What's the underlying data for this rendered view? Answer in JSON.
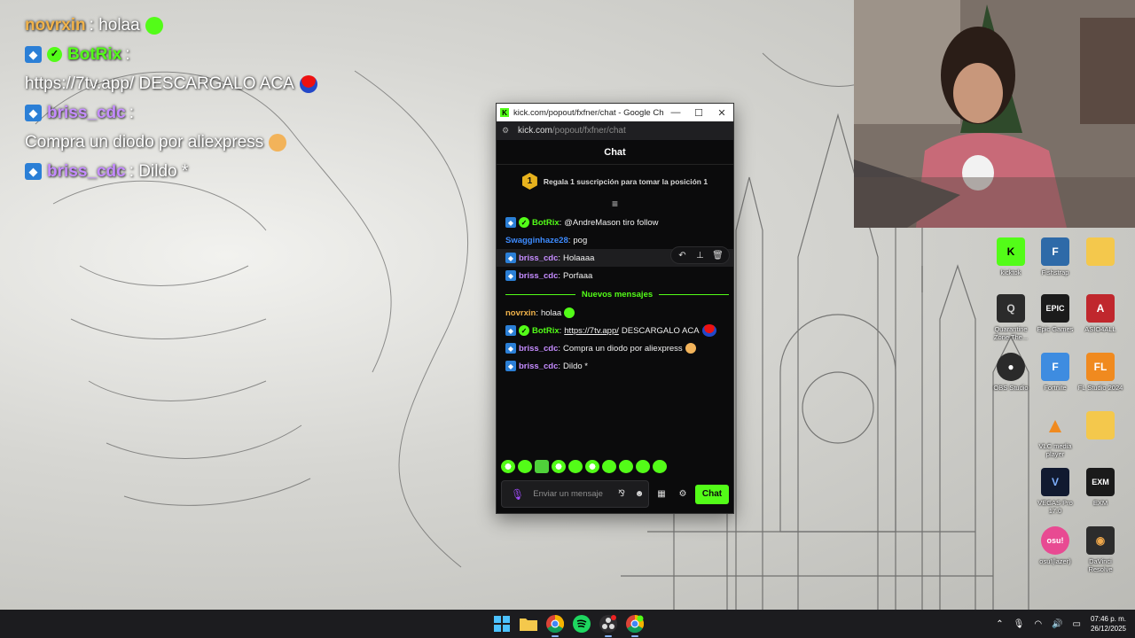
{
  "overlay_chat": [
    {
      "user": "novrxin",
      "user_color": "#f0b24a",
      "text": "holaa",
      "emote": "green",
      "badges": []
    },
    {
      "user": "BotRix",
      "user_color": "#53fc18",
      "text": "https://7tv.app/ DESCARGALO ACA",
      "emote": "santa",
      "badges": [
        "sub",
        "verified"
      ]
    },
    {
      "user": "briss_cdc",
      "user_color": "#c58cff",
      "text": "Compra un diodo por aliexpress",
      "emote": "smile",
      "badges": [
        "sub"
      ]
    },
    {
      "user": "briss_cdc",
      "user_color": "#c58cff",
      "text": "Dildo *",
      "emote": "",
      "badges": [
        "sub"
      ]
    }
  ],
  "popout": {
    "window_title": "kick.com/popout/fxfner/chat - Google Chro...",
    "favicon": "K",
    "address_domain": "kick.com",
    "address_path": "/popout/fxfner/chat",
    "header_title": "Chat",
    "pinned_rank": "1",
    "pinned_text": "Regala 1 suscripción para tomar la posición 1",
    "collapse_icon": "≡",
    "messages_top": [
      {
        "user": "BotRix",
        "color": "#53fc18",
        "text": "@AndreMason tiro follow",
        "badges": [
          "sub",
          "verified"
        ]
      },
      {
        "user": "Swagginhaze28",
        "color": "#3d8bff",
        "text": "pog",
        "badges": []
      },
      {
        "user": "briss_cdc",
        "color": "#c58cff",
        "text": "Holaaaa",
        "badges": [
          "sub"
        ]
      },
      {
        "user": "briss_cdc",
        "color": "#c58cff",
        "text": "Porfaaa",
        "badges": [
          "sub"
        ]
      }
    ],
    "new_messages_label": "Nuevos mensajes",
    "messages_new": [
      {
        "user": "novrxin",
        "color": "#f0b24a",
        "text": "holaa",
        "badges": []
      },
      {
        "user": "BotRix",
        "color": "#53fc18",
        "link": "https://7tv.app/",
        "text": "DESCARGALO ACA",
        "badges": [
          "sub",
          "verified"
        ]
      },
      {
        "user": "briss_cdc",
        "color": "#c58cff",
        "text": "Compra un diodo por aliexpress",
        "badges": [
          "sub"
        ]
      },
      {
        "user": "briss_cdc",
        "color": "#c58cff",
        "text": "Dildo *",
        "badges": [
          "sub"
        ]
      }
    ],
    "input_placeholder": "Enviar un mensaje",
    "send_label": "Chat"
  },
  "desktop_icons": [
    {
      "label": "kicktok",
      "color": "#53fc18",
      "glyph": "K"
    },
    {
      "label": "Fishstrap",
      "color": "#2e6aa8",
      "glyph": "F"
    },
    {
      "label": "",
      "color": "#f4c84c",
      "glyph": ""
    },
    {
      "label": "Quarantine Zone The...",
      "color": "#2b2b2b",
      "glyph": "Q"
    },
    {
      "label": "Epic Games",
      "color": "#1b1b1b",
      "glyph": "EPIC"
    },
    {
      "label": "ASIO4ALL",
      "color": "#c0272d",
      "glyph": "A"
    },
    {
      "label": "OBS Studio",
      "color": "#2a2a2a",
      "glyph": "●"
    },
    {
      "label": "Fortnite",
      "color": "#3e8ce0",
      "glyph": "F"
    },
    {
      "label": "FL Studio 2024",
      "color": "#f08a1f",
      "glyph": "FL"
    },
    {
      "label": "VLC media player",
      "color": "#f08a1f",
      "glyph": "▲"
    },
    {
      "label": "",
      "color": "#f4c84c",
      "glyph": ""
    },
    {
      "label": "VEGAS Pro 17.0",
      "color": "#111a30",
      "glyph": "V"
    },
    {
      "label": "EXM",
      "color": "#1a1a1a",
      "glyph": "EXM"
    },
    {
      "label": "osu!(lazer)",
      "color": "#e84a92",
      "glyph": "osu!"
    },
    {
      "label": "DaVinci Resolve",
      "color": "#2c2c2c",
      "glyph": "◉"
    }
  ],
  "taskbar": {
    "apps": [
      "windows-start",
      "file-explorer",
      "chrome",
      "spotify",
      "obs",
      "chrome-profile"
    ],
    "time": "07:46 p. m.",
    "date": "26/12/2025"
  }
}
